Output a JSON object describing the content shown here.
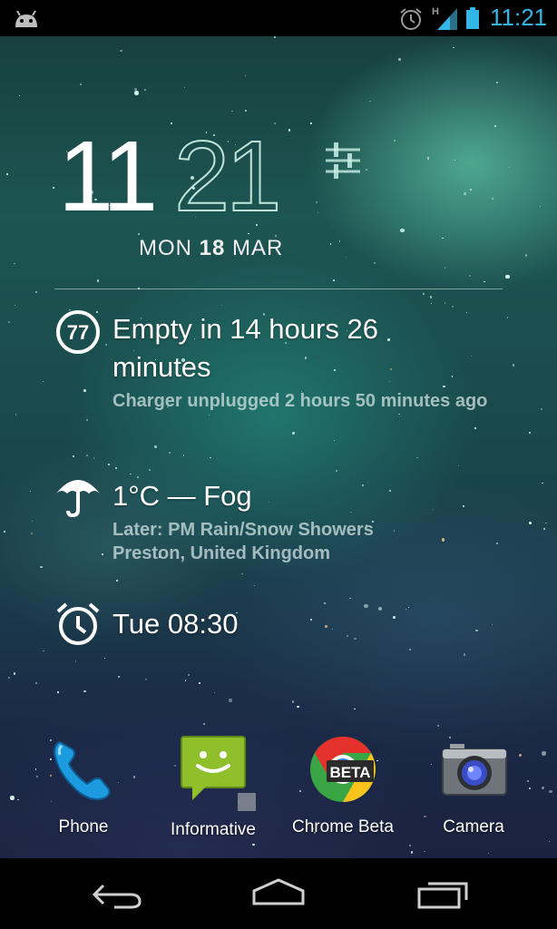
{
  "status_bar": {
    "time": "11:21",
    "network_type": "H",
    "icons": [
      "android-icon",
      "alarm-icon",
      "signal-icon",
      "battery-icon"
    ],
    "accent_color": "#33b5e5"
  },
  "clock": {
    "hour": "11",
    "minute": "21",
    "date_day": "MON",
    "date_num": "18",
    "date_month": "MAR"
  },
  "battery_row": {
    "badge": "77",
    "title": "Empty in 14 hours 26 minutes",
    "subtitle": "Charger unplugged 2 hours 50 minutes ago"
  },
  "weather_row": {
    "title": "1°C — Fog",
    "subtitle_line1": "Later: PM Rain/Snow Showers",
    "subtitle_line2": "Preston, United Kingdom"
  },
  "alarm_row": {
    "title": "Tue 08:30"
  },
  "dock": {
    "apps": [
      {
        "label": "Phone",
        "icon": "phone-icon"
      },
      {
        "label": "Informative",
        "icon": "messaging-icon"
      },
      {
        "label": "Chrome Beta",
        "icon": "chrome-beta-icon",
        "badge": "BETA"
      },
      {
        "label": "Camera",
        "icon": "camera-icon"
      }
    ]
  },
  "nav_bar": {
    "buttons": [
      "back-icon",
      "home-icon",
      "recents-icon"
    ]
  }
}
